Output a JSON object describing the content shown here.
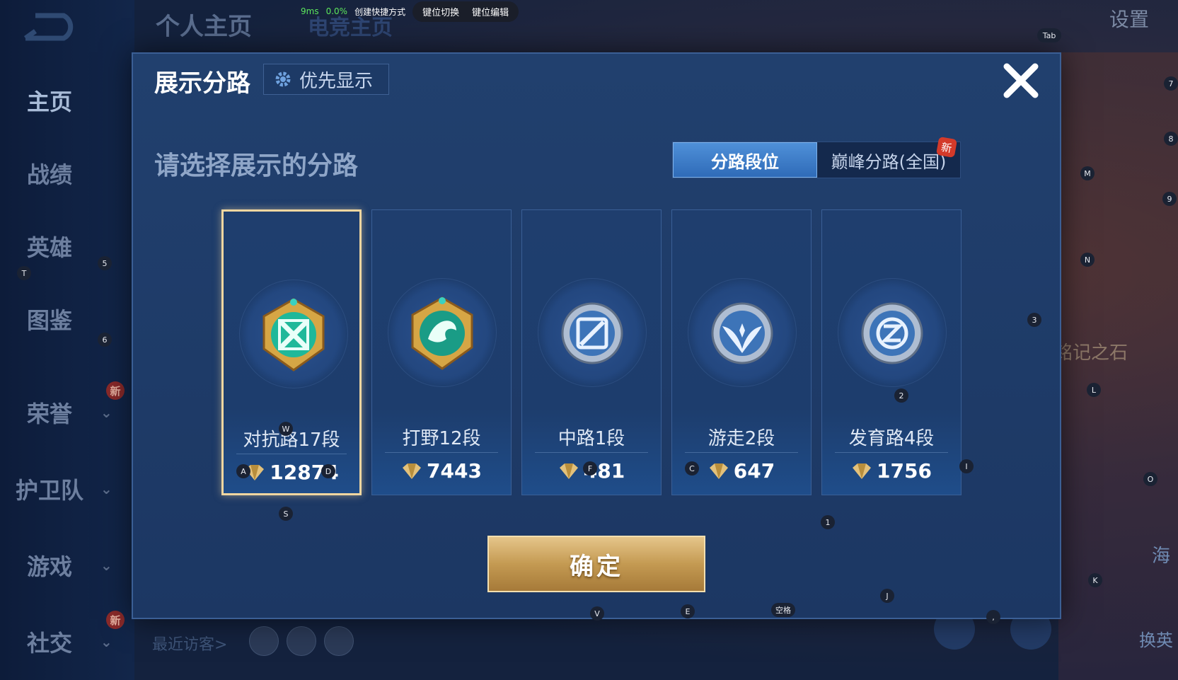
{
  "topbar": {
    "title": "个人主页",
    "title2": "电竞主页",
    "settings": "设置"
  },
  "overlay": {
    "ping": "9ms",
    "loss": "0.0%",
    "shortcut": "创建快捷方式",
    "switch": "键位切换",
    "edit": "键位编辑"
  },
  "sidebar": {
    "items": [
      {
        "label": "主页",
        "active": true
      },
      {
        "label": "战绩"
      },
      {
        "label": "英雄"
      },
      {
        "label": "图鉴"
      },
      {
        "label": "荣誉",
        "new": "新"
      },
      {
        "label": "护卫队"
      },
      {
        "label": "游戏"
      },
      {
        "label": "社交",
        "new": "新"
      }
    ]
  },
  "modal": {
    "title": "展示分路",
    "priority_label": "优先显示",
    "subtitle": "请选择展示的分路",
    "tabs": [
      {
        "label": "分路段位",
        "active": true
      },
      {
        "label": "巅峰分路(全国)",
        "badge": "新"
      }
    ],
    "cards": [
      {
        "rank": "对抗路17段",
        "score": "12874",
        "selected": true,
        "emblem": "clash-lane-emblem-icon"
      },
      {
        "rank": "打野12段",
        "score": "7443",
        "emblem": "jungle-emblem-icon"
      },
      {
        "rank": "中路1段",
        "score": "481",
        "emblem": "mid-lane-emblem-icon"
      },
      {
        "rank": "游走2段",
        "score": "647",
        "emblem": "roam-emblem-icon"
      },
      {
        "rank": "发育路4段",
        "score": "1756",
        "emblem": "farm-lane-emblem-icon"
      }
    ],
    "confirm_label": "确定"
  },
  "bottom": {
    "visitors_label": "最近访客>"
  },
  "right": {
    "stone": "铭记之石",
    "hai": "海",
    "swap": "换英"
  },
  "keys": {
    "T": "T",
    "5": "5",
    "6": "6",
    "W": "W",
    "A": "A",
    "D": "D",
    "S": "S",
    "F": "F",
    "C": "C",
    "2": "2",
    "I": "I",
    "1": "1",
    "V": "V",
    "E": "E",
    "space": "空格",
    "J": "J",
    "comma": ",",
    "Tab": "Tab",
    "M": "M",
    "N": "N",
    "3": "3",
    "L": "L",
    "O": "O",
    "K": "K",
    "7": "7",
    "8": "8",
    "9": "9"
  },
  "colors": {
    "accent_gold": "#f0d6a0",
    "tab_active": "#3f7dc8",
    "modal_bg": "#21406e"
  }
}
